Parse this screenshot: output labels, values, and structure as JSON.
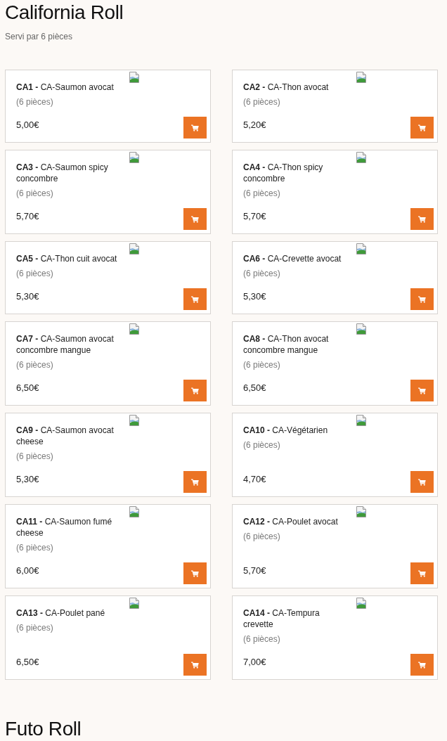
{
  "section": {
    "title": "California Roll",
    "subtitle": "Servi par 6 pièces"
  },
  "products": [
    {
      "title": "**CA1 -** CA-Saumon avocat",
      "pieces": "(6 pièces)",
      "price": "5,00€"
    },
    {
      "title": "**CA2 -** CA-Thon avocat",
      "pieces": "(6 pièces)",
      "price": "5,20€"
    },
    {
      "title": "**CA3 -** CA-Saumon spicy concombre",
      "pieces": "(6 pièces)",
      "price": "5,70€"
    },
    {
      "title": "**CA4 -** CA-Thon spicy concombre",
      "pieces": "(6 pièces)",
      "price": "5,70€"
    },
    {
      "title": "**CA5 -** CA-Thon cuit avocat",
      "pieces": "(6 pièces)",
      "price": "5,30€"
    },
    {
      "title": "**CA6 -** CA-Crevette avocat",
      "pieces": "(6 pièces)",
      "price": "5,30€"
    },
    {
      "title": "**CA7 -** CA-Saumon avocat concombre mangue",
      "pieces": "(6 pièces)",
      "price": "6,50€"
    },
    {
      "title": "**CA8 -** CA-Thon avocat concombre mangue",
      "pieces": "(6 pièces)",
      "price": "6,50€"
    },
    {
      "title": "**CA9 -** CA-Saumon avocat cheese",
      "pieces": "(6 pièces)",
      "price": "5,30€"
    },
    {
      "title": "**CA10 -** CA-Végétarien",
      "pieces": "(6 pièces)",
      "price": "4,70€"
    },
    {
      "title": "**CA11 -** CA-Saumon fumé cheese",
      "pieces": "(6 pièces)",
      "price": "6,00€"
    },
    {
      "title": "**CA12 -** CA-Poulet avocat",
      "pieces": "(6 pièces)",
      "price": "5,70€"
    },
    {
      "title": "**CA13 -** CA-Poulet pané",
      "pieces": "(6 pièces)",
      "price": "6,50€"
    },
    {
      "title": "**CA14 -** CA-Tempura crevette",
      "pieces": "(6 pièces)",
      "price": "7,00€"
    }
  ],
  "next_section": {
    "title": "Futo Roll"
  }
}
